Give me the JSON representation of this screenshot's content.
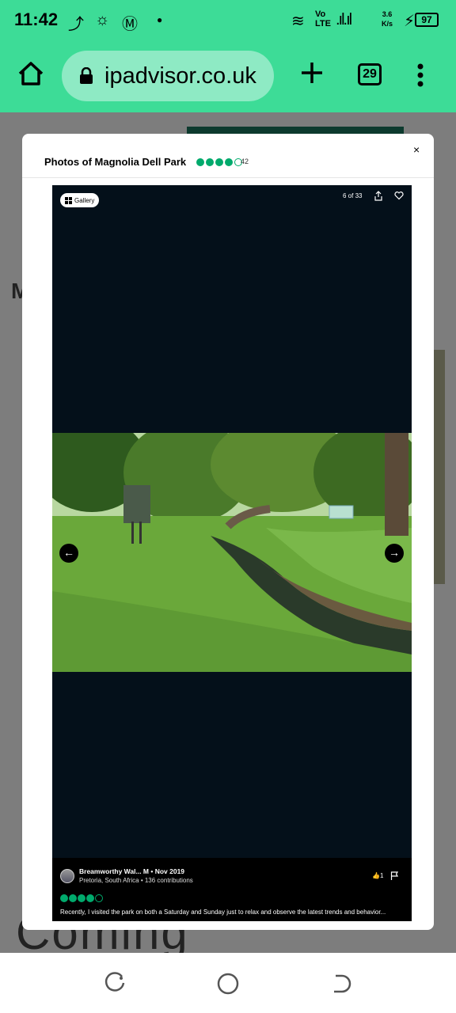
{
  "status": {
    "time": "11:42",
    "net_gen": "Vo",
    "net_type": "LTE",
    "speed": "3.6",
    "speed_unit": "K/s",
    "battery": "97"
  },
  "browser": {
    "url": "ipadvisor.co.uk",
    "tab_count": "29"
  },
  "background": {
    "big_letter": "M",
    "coming": "Coming"
  },
  "modal": {
    "title": "Photos of Magnolia Dell Park",
    "rating": 4,
    "rating_max": 5,
    "review_count": "42",
    "close": "×"
  },
  "viewer": {
    "gallery_label": "Gallery",
    "counter": "6 of 33",
    "prev": "←",
    "next": "→"
  },
  "caption": {
    "author": "Breamworthy Wal... M • Nov 2019",
    "location": "Pretoria, South Africa",
    "contributions": "136 contributions",
    "likes": "1",
    "rating": 4,
    "text": "Recently, I visited the park on both a Saturday and Sunday just to relax and observe the latest trends and behavior..."
  },
  "colors": {
    "brand": "#3ddc97",
    "bubble": "#00aa6c"
  }
}
